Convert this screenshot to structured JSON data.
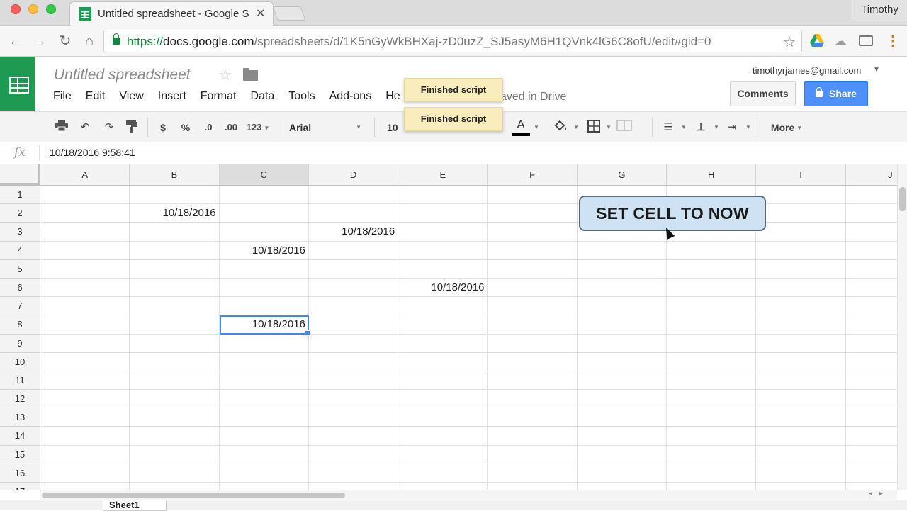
{
  "browser": {
    "tab_title": "Untitled spreadsheet - Google Sheets",
    "tab_close": "✕",
    "profile_name": "Timothy",
    "url_scheme": "https://",
    "url_host": "docs.google.com",
    "url_path": "/spreadsheets/d/1K5nGyWkBHXaj-zD0uzZ_SJ5asyM6H1QVnk4lG6C8ofU/edit#gid=0",
    "icons": [
      "back-icon",
      "forward-icon",
      "reload-icon",
      "home-icon",
      "lock-icon",
      "bookmark-star-icon",
      "drive-icon",
      "cloud-icon",
      "cast-icon",
      "menu-dots-icon"
    ]
  },
  "header": {
    "doc_title": "Untitled spreadsheet",
    "account": "timothyrjames@gmail.com",
    "comments_label": "Comments",
    "share_label": "Share",
    "save_status": "aved in Drive",
    "menu": [
      "File",
      "Edit",
      "View",
      "Insert",
      "Format",
      "Data",
      "Tools",
      "Add-ons",
      "He"
    ]
  },
  "toolbar": {
    "currency": "$",
    "percent": "%",
    "decrease_decimals": ".0",
    "increase_decimals": ".00",
    "more_formats": "123",
    "font": "Arial",
    "font_size": "10",
    "text_color": "A",
    "more_label": "More"
  },
  "toasts": [
    "Finished script",
    "Finished script"
  ],
  "formula_bar": {
    "fx": "fx",
    "value": "10/18/2016 9:58:41"
  },
  "grid": {
    "columns": [
      "A",
      "B",
      "C",
      "D",
      "E",
      "F",
      "G",
      "H",
      "I",
      "J"
    ],
    "active_column": "C",
    "rows": [
      {
        "num": "1",
        "cells": [
          "",
          "",
          "",
          "",
          "",
          "",
          "",
          "",
          "",
          ""
        ]
      },
      {
        "num": "2",
        "cells": [
          "",
          "10/18/2016",
          "",
          "",
          "",
          "",
          "",
          "",
          "",
          ""
        ]
      },
      {
        "num": "3",
        "cells": [
          "",
          "",
          "",
          "10/18/2016",
          "",
          "",
          "",
          "",
          "",
          ""
        ]
      },
      {
        "num": "4",
        "cells": [
          "",
          "",
          "10/18/2016",
          "",
          "",
          "",
          "",
          "",
          "",
          ""
        ]
      },
      {
        "num": "5",
        "cells": [
          "",
          "",
          "",
          "",
          "",
          "",
          "",
          "",
          "",
          ""
        ]
      },
      {
        "num": "6",
        "cells": [
          "",
          "",
          "",
          "",
          "10/18/2016",
          "",
          "",
          "",
          "",
          ""
        ]
      },
      {
        "num": "7",
        "cells": [
          "",
          "",
          "",
          "",
          "",
          "",
          "",
          "",
          "",
          ""
        ]
      },
      {
        "num": "8",
        "cells": [
          "",
          "",
          "10/18/2016",
          "",
          "",
          "",
          "",
          "",
          "",
          ""
        ]
      },
      {
        "num": "9",
        "cells": [
          "",
          "",
          "",
          "",
          "",
          "",
          "",
          "",
          "",
          ""
        ]
      },
      {
        "num": "10",
        "cells": [
          "",
          "",
          "",
          "",
          "",
          "",
          "",
          "",
          "",
          ""
        ]
      },
      {
        "num": "11",
        "cells": [
          "",
          "",
          "",
          "",
          "",
          "",
          "",
          "",
          "",
          ""
        ]
      },
      {
        "num": "12",
        "cells": [
          "",
          "",
          "",
          "",
          "",
          "",
          "",
          "",
          "",
          ""
        ]
      },
      {
        "num": "13",
        "cells": [
          "",
          "",
          "",
          "",
          "",
          "",
          "",
          "",
          "",
          ""
        ]
      },
      {
        "num": "14",
        "cells": [
          "",
          "",
          "",
          "",
          "",
          "",
          "",
          "",
          "",
          ""
        ]
      },
      {
        "num": "15",
        "cells": [
          "",
          "",
          "",
          "",
          "",
          "",
          "",
          "",
          "",
          ""
        ]
      },
      {
        "num": "16",
        "cells": [
          "",
          "",
          "",
          "",
          "",
          "",
          "",
          "",
          "",
          ""
        ]
      },
      {
        "num": "17",
        "cells": [
          "",
          "",
          "",
          "",
          "",
          "",
          "",
          "",
          "",
          ""
        ]
      }
    ],
    "selected_cell": "C8"
  },
  "drawing_button_label": "SET CELL TO NOW",
  "sheet_tab": "Sheet1",
  "colors": {
    "sheets_green": "#1e9a52",
    "share_blue": "#4d90fe",
    "selection_blue": "#4285f4",
    "button_fill": "#cfe2f3",
    "toast_bg": "#f9edbe"
  }
}
